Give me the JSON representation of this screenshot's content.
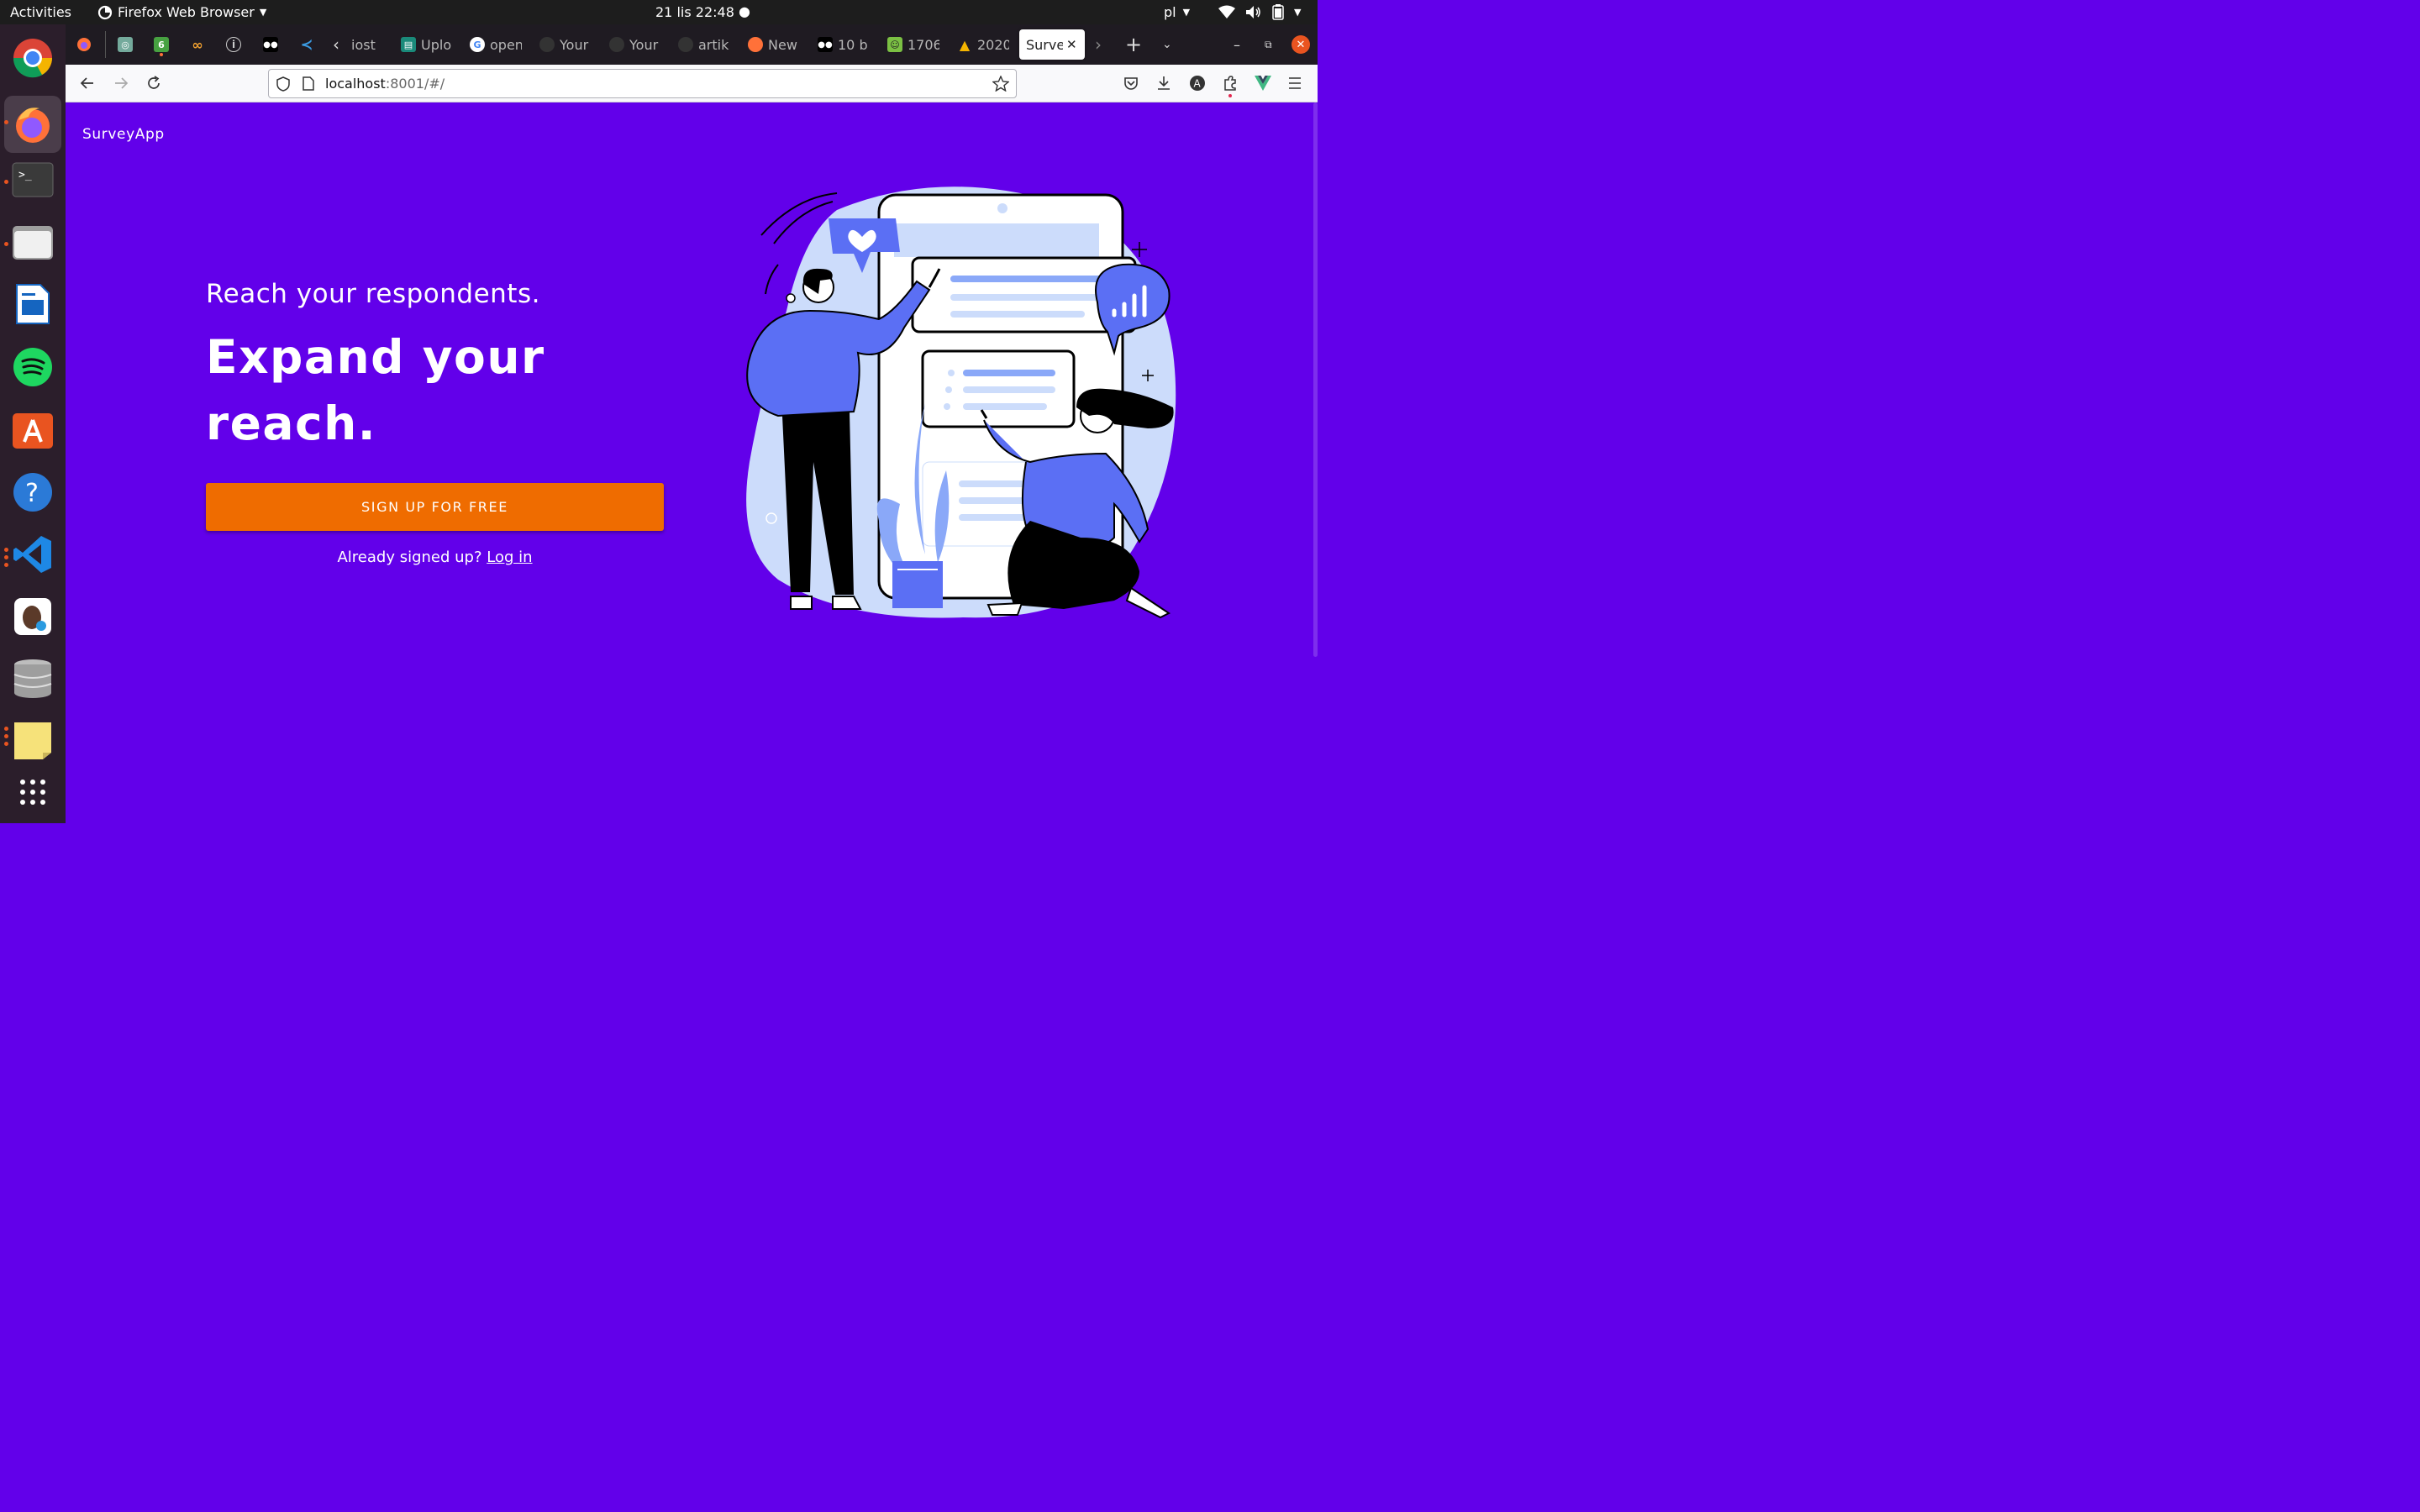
{
  "topbar": {
    "activities": "Activities",
    "app_name": "Firefox Web Browser",
    "clock": "21 lis  22:48",
    "language": "pl"
  },
  "dock": {
    "apps": [
      "chrome-icon",
      "firefox-icon",
      "terminal-icon",
      "files-icon",
      "writer-icon",
      "spotify-icon",
      "app-center-icon",
      "help-icon",
      "vscode-icon",
      "dbeaver-icon",
      "database-icon",
      "notes-icon",
      "show-apps-icon"
    ]
  },
  "tabs": {
    "items": [
      {
        "label": "iost",
        "color": "#4a4a4a"
      },
      {
        "label": "Uplo",
        "color": "#1a8a7a"
      },
      {
        "label": "open",
        "color": "#ffffff"
      },
      {
        "label": "Your",
        "color": "#333333"
      },
      {
        "label": "Your",
        "color": "#333333"
      },
      {
        "label": "artik",
        "color": "#333333"
      },
      {
        "label": "New",
        "color": "#ff7139"
      },
      {
        "label": "10 b",
        "color": "#000000"
      },
      {
        "label": "1706",
        "color": "#7bc043"
      },
      {
        "label": "2020",
        "color": "#1fa463"
      }
    ],
    "active_label": "Surve",
    "colors": {
      "accent": "#6200ea",
      "button": "#ef6c00",
      "close": "#e95420"
    }
  },
  "url": {
    "host": "localhost",
    "rest": ":8001/#/"
  },
  "page": {
    "brand": "SurveyApp",
    "subtitle": "Reach your respondents.",
    "headline": "Expand your reach.",
    "cta": "SIGN UP FOR FREE",
    "already": "Already signed up?",
    "login": "Log in"
  }
}
